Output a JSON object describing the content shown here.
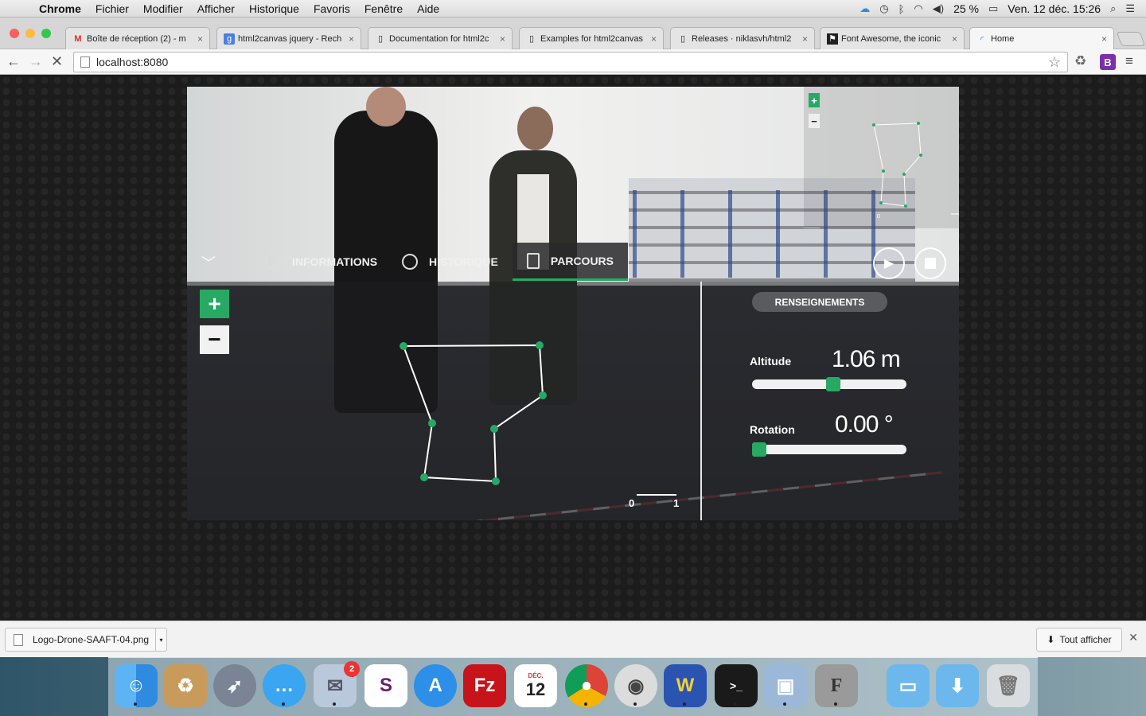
{
  "menubar": {
    "app_name": "Chrome",
    "items": [
      "Fichier",
      "Modifier",
      "Afficher",
      "Historique",
      "Favoris",
      "Fenêtre",
      "Aide"
    ],
    "battery": "25 %",
    "clock": "Ven. 12 déc.  15:26"
  },
  "tabs": [
    {
      "title": "Boîte de réception (2) - m",
      "icon": "gmail-icon"
    },
    {
      "title": "html2canvas jquery - Rech",
      "icon": "google-icon"
    },
    {
      "title": "Documentation for html2c",
      "icon": "document-icon"
    },
    {
      "title": "Examples for html2canvas",
      "icon": "document-icon"
    },
    {
      "title": "Releases · niklasvh/html2",
      "icon": "document-icon"
    },
    {
      "title": "Font Awesome, the iconic",
      "icon": "flag-icon"
    },
    {
      "title": "Home",
      "icon": "loading-icon"
    }
  ],
  "address": {
    "url": "localhost:8080"
  },
  "app": {
    "nav_tabs": [
      {
        "label": "INFORMATIONS",
        "icon": "dashboard-icon"
      },
      {
        "label": "HISTORIQUE",
        "icon": "clock-icon"
      },
      {
        "label": "PARCOURS",
        "icon": "route-icon"
      }
    ],
    "active_tab": "PARCOURS",
    "panel_button": "RENSEIGNEMENTS",
    "altitude_label": "Altitude",
    "altitude_value": "1.06 m",
    "altitude_level": 0.53,
    "rotation_label": "Rotation",
    "rotation_value": "0.00 °",
    "rotation_level": 0.0,
    "scale_min": "0",
    "scale_max": "1",
    "accent": "#27a963",
    "minimap_label": "0"
  },
  "download": {
    "filename": "Logo-Drone-SAAFT-04.png",
    "show_all": "Tout afficher"
  },
  "dock": {
    "apps": [
      "finder",
      "archive",
      "rocket",
      "messages",
      "mail",
      "slack",
      "app-store",
      "filezilla",
      "calendar",
      "chrome",
      "sequel-pro",
      "eclipse",
      "terminal",
      "virtualbox",
      "fontforge",
      "folder",
      "downloads",
      "trash"
    ],
    "calendar_month": "DÉC.",
    "calendar_day": "12",
    "mail_badge": "2"
  }
}
